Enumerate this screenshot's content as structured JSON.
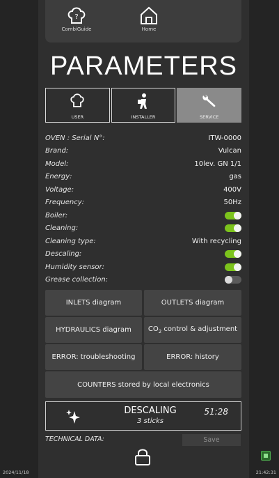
{
  "nav": {
    "combiguide_label": "CombiGuide",
    "home_label": "Home"
  },
  "page_title": "PARAMETERS",
  "tabs": [
    {
      "label": "USER",
      "icon": "chef-hat-icon",
      "active": false
    },
    {
      "label": "INSTALLER",
      "icon": "installer-icon",
      "active": false
    },
    {
      "label": "SERVICE",
      "icon": "wrench-icon",
      "active": true
    }
  ],
  "info": {
    "serial": {
      "label": "OVEN : Serial N°:",
      "value": "ITW-0000"
    },
    "brand": {
      "label": "Brand:",
      "value": "Vulcan"
    },
    "model": {
      "label": "Model:",
      "value": "10lev. GN 1/1"
    },
    "energy": {
      "label": "Energy:",
      "value": "gas"
    },
    "voltage": {
      "label": "Voltage:",
      "value": "400V"
    },
    "frequency": {
      "label": "Frequency:",
      "value": "50Hz"
    },
    "boiler": {
      "label": "Boiler:",
      "on": true
    },
    "cleaning": {
      "label": "Cleaning:",
      "on": true
    },
    "cleaning_type": {
      "label": "Cleaning type:",
      "value": "With recycling"
    },
    "descaling": {
      "label": "Descaling:",
      "on": true
    },
    "humidity_sensor": {
      "label": "Humidity sensor:",
      "on": true
    },
    "grease_collection": {
      "label": "Grease collection:",
      "on": false
    }
  },
  "buttons": {
    "inlets": "INLETS diagram",
    "outlets": "OUTLETS diagram",
    "hydraulics": "HYDRAULICS diagram",
    "co2_pre": "CO",
    "co2_sub": "2",
    "co2_post": " control & adjustment",
    "error_troubleshooting": "ERROR: troubleshooting",
    "error_history": "ERROR: history",
    "counters": "COUNTERS stored by local electronics"
  },
  "descaling_panel": {
    "title": "DESCALING",
    "subtitle": "3 sticks",
    "time": "51:28"
  },
  "technical_data_label": "TECHNICAL DATA:",
  "save_label": "Save",
  "footer": {
    "date": "2024/11/18",
    "time": "21:42:31"
  },
  "colors": {
    "toggle_on": "#7cc31c",
    "active_tab": "#8a8a8a",
    "button_bg": "#444444"
  }
}
